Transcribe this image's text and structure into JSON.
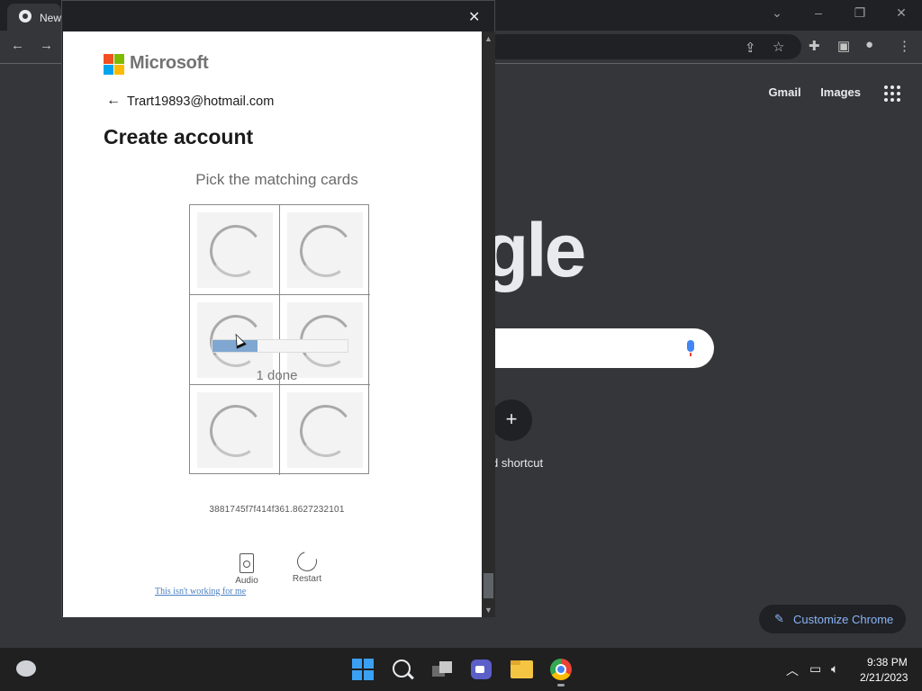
{
  "chrome": {
    "tab_title": "New",
    "header_links": [
      "Gmail",
      "Images"
    ],
    "google_logo_text": "gle",
    "shortcut_label": "d shortcut",
    "customize_label": "Customize Chrome"
  },
  "popup": {
    "brand": "Microsoft",
    "email": "Trart19893@hotmail.com",
    "title": "Create account",
    "captcha": {
      "prompt": "Pick the matching cards",
      "cards": 6,
      "progress_fraction": 0.33,
      "progress_text": "1 done",
      "session_id": "3881745f7f414f361.8627232101",
      "audio_label": "Audio",
      "restart_label": "Restart",
      "help_link": "This isn't working for me"
    }
  },
  "taskbar": {
    "time": "9:38 PM",
    "date": "2/21/2023"
  },
  "colors": {
    "ms_red": "#f25022",
    "ms_green": "#7fba00",
    "ms_blue": "#00a4ef",
    "ms_yellow": "#ffb900",
    "accent_link": "#8ab4f8"
  }
}
